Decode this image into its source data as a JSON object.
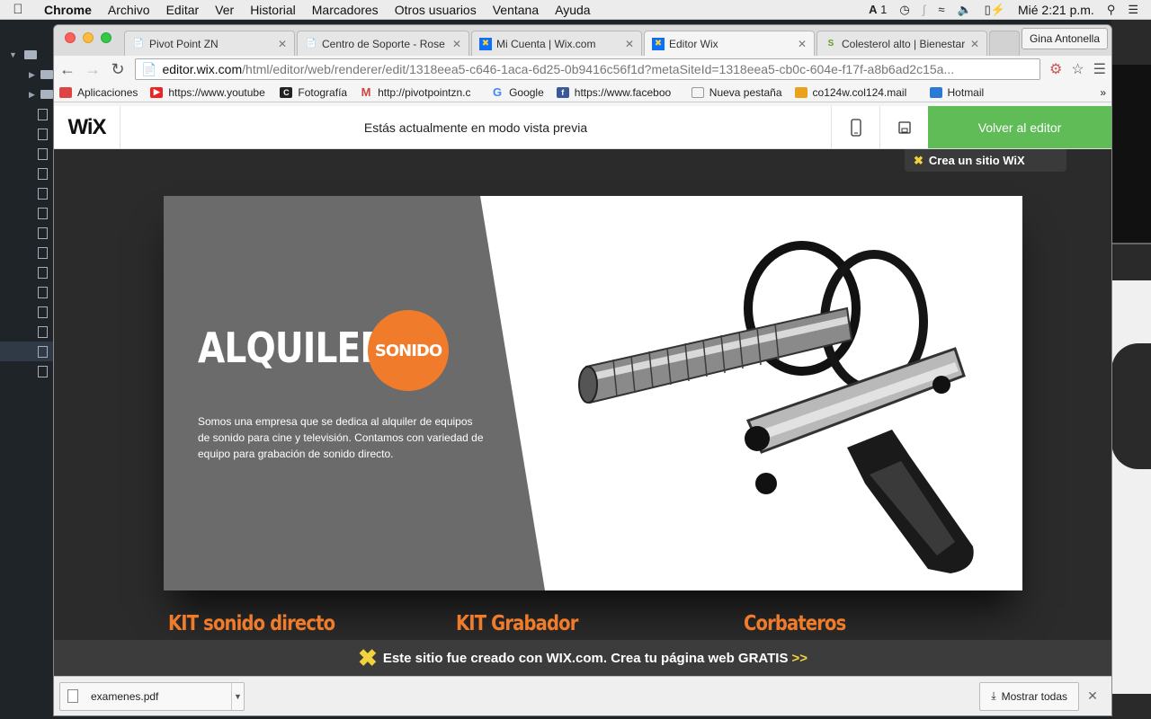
{
  "menubar": {
    "app": "Chrome",
    "items": [
      "Archivo",
      "Editar",
      "Ver",
      "Historial",
      "Marcadores",
      "Otros usuarios",
      "Ventana",
      "Ayuda"
    ],
    "status_badge": "1",
    "clock": "Mié 2:21 p.m."
  },
  "tabs": [
    {
      "title": "Pivot Point ZN",
      "icon": "page-icon"
    },
    {
      "title": "Centro de Soporte - Rose",
      "icon": "page-icon"
    },
    {
      "title": "Mi Cuenta | Wix.com",
      "icon": "wix-icon"
    },
    {
      "title": "Editor Wix",
      "icon": "wix-icon",
      "active": true
    },
    {
      "title": "Colesterol alto | Bienestar",
      "icon": "page-icon"
    }
  ],
  "profile_name": "Gina Antonella",
  "address": {
    "host": "editor.wix.com",
    "path": "/html/editor/web/renderer/edit/1318eea5-c646-1aca-6d25-0b9416c56f1d?metaSiteId=1318eea5-cb0c-604e-f17f-a8b6ad2c15a..."
  },
  "bookmarks": [
    {
      "label": "Aplicaciones",
      "color": "#d44"
    },
    {
      "label": "https://www.youtube",
      "color": "#e22"
    },
    {
      "label": "Fotografía",
      "color": "#222"
    },
    {
      "label": "http://pivotpointzn.c",
      "color": "#c44"
    },
    {
      "label": "Google",
      "color": "#4285f4"
    },
    {
      "label": "https://www.faceboo",
      "color": "#3b5998"
    },
    {
      "label": "Nueva pestaña",
      "color": "#999"
    },
    {
      "label": "co124w.col124.mail",
      "color": "#e8a21b"
    },
    {
      "label": "Hotmail",
      "color": "#2a7ad5"
    }
  ],
  "wix_bar": {
    "logo": "WiX",
    "message": "Estás actualmente en modo vista previa",
    "back_label": "Volver al editor"
  },
  "site": {
    "create_site": "Crea un sitio WiX",
    "heading": "ALQUILER",
    "badge": "SONIDO",
    "description": "Somos una empresa que se dedica al alquiler de equipos de sonido para cine y televisión. Contamos con variedad de equipo para grabación de sonido directo.",
    "sections": [
      "KIT sonido directo",
      "KIT Grabador",
      "Corbateros"
    ],
    "footer_text": "Este sitio fue creado con WIX.com. Crea tu página web GRATIS",
    "footer_arrow": ">>",
    "colors": {
      "accent": "#f07c2b",
      "panel": "#6b6b6b",
      "wix_green": "#60bc57"
    }
  },
  "downloads": {
    "file": "examenes.pdf",
    "show_all": "Mostrar todas"
  }
}
